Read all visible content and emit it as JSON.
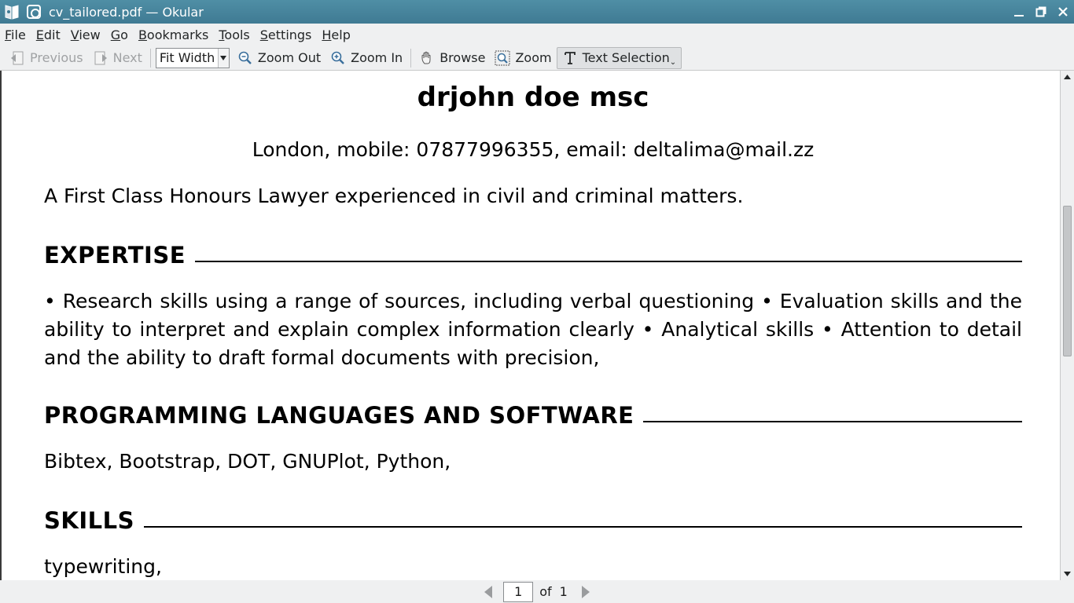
{
  "window": {
    "title": "cv_tailored.pdf — Okular"
  },
  "menubar": {
    "items": [
      {
        "label": "File",
        "accel": "F",
        "rest": "ile"
      },
      {
        "label": "Edit",
        "accel": "E",
        "rest": "dit"
      },
      {
        "label": "View",
        "accel": "V",
        "rest": "iew"
      },
      {
        "label": "Go",
        "accel": "G",
        "rest": "o"
      },
      {
        "label": "Bookmarks",
        "accel": "B",
        "rest": "ookmarks"
      },
      {
        "label": "Tools",
        "accel": "T",
        "rest": "ools"
      },
      {
        "label": "Settings",
        "accel": "S",
        "rest": "ettings"
      },
      {
        "label": "Help",
        "accel": "H",
        "rest": "elp"
      }
    ]
  },
  "toolbar": {
    "previous_label": "Previous",
    "next_label": "Next",
    "zoom_mode": "Fit Width",
    "zoom_out_label": "Zoom Out",
    "zoom_in_label": "Zoom In",
    "browse_label": "Browse",
    "zoom_label": "Zoom",
    "text_selection_label": "Text Selection"
  },
  "document": {
    "name": "drjohn doe msc",
    "contact": "London, mobile: 07877996355, email: deltalima@mail.zz",
    "summary": "A First Class Honours Lawyer experienced in civil and criminal matters.",
    "sections": [
      {
        "title": "EXPERTISE",
        "body": "• Research skills using a range of sources, including verbal questioning • Evaluation skills and the ability to interpret and explain complex information clearly • Analytical skills • Attention to detail and the ability to draft formal documents with precision,"
      },
      {
        "title": "PROGRAMMING LANGUAGES AND SOFTWARE",
        "body": "Bibtex, Bootstrap, DOT, GNUPlot, Python,"
      },
      {
        "title": "SKILLS",
        "body": "typewriting,"
      }
    ]
  },
  "pagenav": {
    "current_page": "1",
    "of_label": "of",
    "total_pages": "1"
  },
  "colors": {
    "titlebar": "#4483a0",
    "toolbar_bg": "#eff0f1"
  }
}
